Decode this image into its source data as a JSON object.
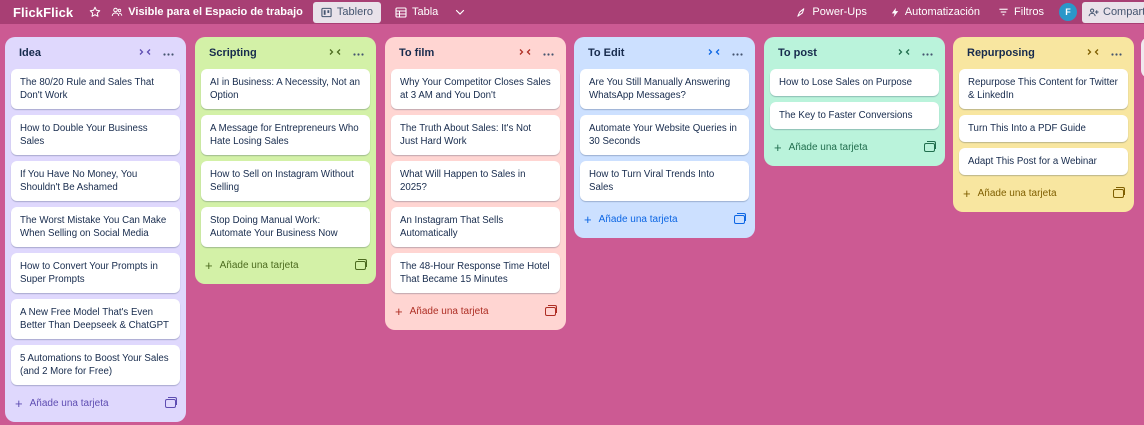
{
  "app": {
    "board_title": "FlickFlick",
    "visibility_label": "Visible para el Espacio de trabajo",
    "views": [
      {
        "label": "Tablero",
        "active": true
      },
      {
        "label": "Tabla",
        "active": false
      }
    ],
    "powerups_label": "Power-Ups",
    "automation_label": "Automatización",
    "filters_label": "Filtros",
    "avatar_initial": "F",
    "share_label": "Compartir"
  },
  "icons": {
    "star": "star-icon",
    "visibility": "people-icon",
    "board_view": "board-icon",
    "table_view": "table-icon",
    "more_views": "chevron-down-icon",
    "powerups": "rocket-icon",
    "automation": "lightning-icon",
    "filters": "filter-icon",
    "share": "share-icon"
  },
  "lists": [
    {
      "title": "Idea",
      "bg": "#dfd8fd",
      "title_color": "#172b4d",
      "accent": "#5e4db2",
      "add_label": "Añade una tarjeta",
      "cards": [
        "The 80/20 Rule and Sales That Don't Work",
        "How to Double Your Business Sales",
        "If You Have No Money, You Shouldn't Be Ashamed",
        "The Worst Mistake You Can Make When Selling on Social Media",
        "How to Convert Your Prompts in Super Prompts",
        "A New Free Model That's Even Better Than Deepseek & ChatGPT",
        "5 Automations to Boost Your Sales (and 2 More for Free)"
      ]
    },
    {
      "title": "Scripting",
      "bg": "#d3f1a7",
      "title_color": "#172b4d",
      "accent": "#4c6b1f",
      "add_label": "Añade una tarjeta",
      "cards": [
        "AI in Business: A Necessity, Not an Option",
        "A Message for Entrepreneurs Who Hate Losing Sales",
        "How to Sell on Instagram Without Selling",
        "Stop Doing Manual Work: Automate Your Business Now"
      ]
    },
    {
      "title": "To film",
      "bg": "#ffd5d2",
      "title_color": "#172b4d",
      "accent": "#ae2e24",
      "add_label": "Añade una tarjeta",
      "cards": [
        "Why Your Competitor Closes Sales at 3 AM and You Don't",
        "The Truth About Sales: It's Not Just Hard Work",
        "What Will Happen to Sales in 2025?",
        "An Instagram That Sells Automatically",
        "The 48-Hour Response Time Hotel That Became 15 Minutes"
      ]
    },
    {
      "title": "To Edit",
      "bg": "#cce0ff",
      "title_color": "#172b4d",
      "accent": "#0c66e4",
      "add_label": "Añade una tarjeta",
      "cards": [
        "Are You Still Manually Answering WhatsApp Messages?",
        "Automate Your Website Queries in 30 Seconds",
        "How to Turn Viral Trends Into Sales"
      ]
    },
    {
      "title": "To post",
      "bg": "#baf3db",
      "title_color": "#172b4d",
      "accent": "#216e4e",
      "add_label": "Añade una tarjeta",
      "cards": [
        "How to Lose Sales on Purpose",
        "The Key to Faster Conversions"
      ]
    },
    {
      "title": "Repurposing",
      "bg": "#f8e6a0",
      "title_color": "#172b4d",
      "accent": "#7f5f01",
      "add_label": "Añade una tarjeta",
      "cards": [
        "Repurpose This Content for Twitter & LinkedIn",
        "Turn This Into a PDF Guide",
        "Adapt This Post for a Webinar"
      ]
    }
  ]
}
